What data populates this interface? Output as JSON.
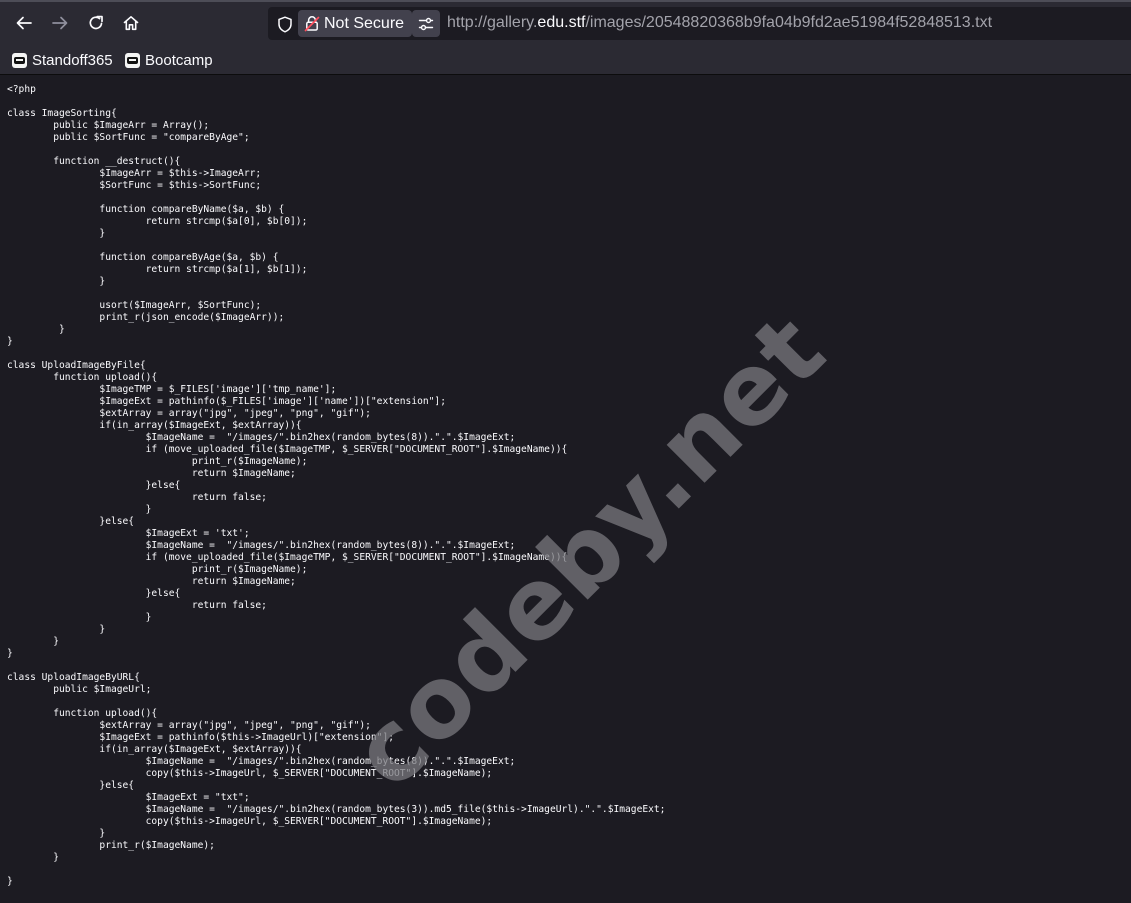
{
  "toolbar": {
    "back_icon": "arrow-left-icon",
    "forward_icon": "arrow-right-icon",
    "reload_icon": "reload-icon",
    "home_icon": "home-icon"
  },
  "urlbar": {
    "security_label": "Not Secure",
    "url_prefix": "http://gallery.",
    "url_host": "edu.stf",
    "url_path": "/images/20548820368b9fa04b9fd2ae51984f52848513.txt"
  },
  "bookmarks": [
    {
      "label": "Standoff365",
      "icon": "standoff-icon"
    },
    {
      "label": "Bootcamp",
      "icon": "bootcamp-icon"
    }
  ],
  "page": {
    "code": "<?php\n\nclass ImageSorting{\n\tpublic $ImageArr = Array();\n\tpublic $SortFunc = \"compareByAge\";\n\n\tfunction __destruct(){\n\t\t$ImageArr = $this->ImageArr;\n\t\t$SortFunc = $this->SortFunc;\n\n\t\tfunction compareByName($a, $b) {\n\t\t\treturn strcmp($a[0], $b[0]);\n\t\t}\n\n\t\tfunction compareByAge($a, $b) {\n\t\t\treturn strcmp($a[1], $b[1]);\n\t\t}\n\n\t\tusort($ImageArr, $SortFunc);\n\t\tprint_r(json_encode($ImageArr));\n\t }\n}\n\nclass UploadImageByFile{\n\tfunction upload(){\n\t\t$ImageTMP = $_FILES['image']['tmp_name'];\n\t\t$ImageExt = pathinfo($_FILES['image']['name'])[\"extension\"];\n\t\t$extArray = array(\"jpg\", \"jpeg\", \"png\", \"gif\");\n\t\tif(in_array($ImageExt, $extArray)){\n\t\t\t$ImageName =  \"/images/\".bin2hex(random_bytes(8)).\".\".$ImageExt;\n\t\t\tif (move_uploaded_file($ImageTMP, $_SERVER[\"DOCUMENT_ROOT\"].$ImageName)){\n\t\t\t\tprint_r($ImageName);\n\t\t\t\treturn $ImageName;\n\t\t\t}else{\n\t\t\t\treturn false;\n\t\t\t}\n\t\t}else{\n\t\t\t$ImageExt = 'txt';\n\t\t\t$ImageName =  \"/images/\".bin2hex(random_bytes(8)).\".\".$ImageExt;\n\t\t\tif (move_uploaded_file($ImageTMP, $_SERVER[\"DOCUMENT_ROOT\"].$ImageName)){\n\t\t\t\tprint_r($ImageName);\n\t\t\t\treturn $ImageName;\n\t\t\t}else{\n\t\t\t\treturn false;\n\t\t\t}\n\t\t}\n\t}\n}\n\nclass UploadImageByURL{\n\tpublic $ImageUrl;\n\n\tfunction upload(){\n\t\t$extArray = array(\"jpg\", \"jpeg\", \"png\", \"gif\");\n\t\t$ImageExt = pathinfo($this->ImageUrl)[\"extension\"];\n\t\tif(in_array($ImageExt, $extArray)){\n\t\t\t$ImageName =  \"/images/\".bin2hex(random_bytes(8)).\".\".$ImageExt;\n\t\t\tcopy($this->ImageUrl, $_SERVER[\"DOCUMENT_ROOT\"].$ImageName);\n\t\t}else{\n\t\t\t$ImageExt = \"txt\";\n\t\t\t$ImageName =  \"/images/\".bin2hex(random_bytes(3)).md5_file($this->ImageUrl).\".\".$ImageExt;\n\t\t\tcopy($this->ImageUrl, $_SERVER[\"DOCUMENT_ROOT\"].$ImageName);\n\t\t}\n\t\tprint_r($ImageName);\n\t}\n\n}"
  },
  "watermark": {
    "text": "codeby.net"
  }
}
